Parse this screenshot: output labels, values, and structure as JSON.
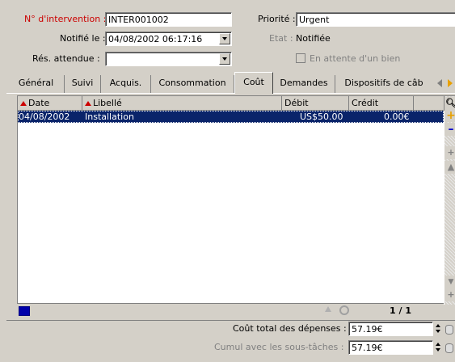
{
  "form": {
    "intervention_label": "N° d'intervention :",
    "intervention_value": "INTER001002",
    "priorite_label": "Priorité :",
    "priorite_value": "Urgent",
    "notifie_label": "Notifié le :",
    "notifie_value": "04/08/2002 06:17:16",
    "etat_label": "Etat :",
    "etat_value": "Notifiée",
    "res_label": "Rés. attendue :",
    "res_value": "",
    "attente_label": "En attente d'un bien",
    "attente_checked": false
  },
  "tabs": [
    {
      "label": "Général"
    },
    {
      "label": "Suivi"
    },
    {
      "label": "Acquis."
    },
    {
      "label": "Consommation"
    },
    {
      "label": "Coût",
      "active": true
    },
    {
      "label": "Demandes"
    },
    {
      "label": "Dispositifs de câb"
    }
  ],
  "table": {
    "columns": [
      "Date",
      "Libellé",
      "Débit",
      "Crédit"
    ],
    "rows": [
      {
        "date": "04/08/2002",
        "libelle": "Installation",
        "debit": "US$50.00",
        "credit": "0.00€"
      }
    ],
    "pagination": "1 / 1"
  },
  "totals": {
    "total_label": "Coût total des dépenses :",
    "total_value": "57.19€",
    "cumul_label": "Cumul avec les sous-tâches :",
    "cumul_value": "57.19€"
  },
  "icons": [
    "zoom-icon",
    "add-icon",
    "remove-icon",
    "tab-scroll-left-icon",
    "tab-scroll-right-icon",
    "grid-view-icon",
    "refresh-icon",
    "currency-icon"
  ],
  "colors": {
    "required_label": "#cc0000",
    "selection": "#0a246a",
    "add": "#e8a000",
    "remove": "#0000cc"
  }
}
